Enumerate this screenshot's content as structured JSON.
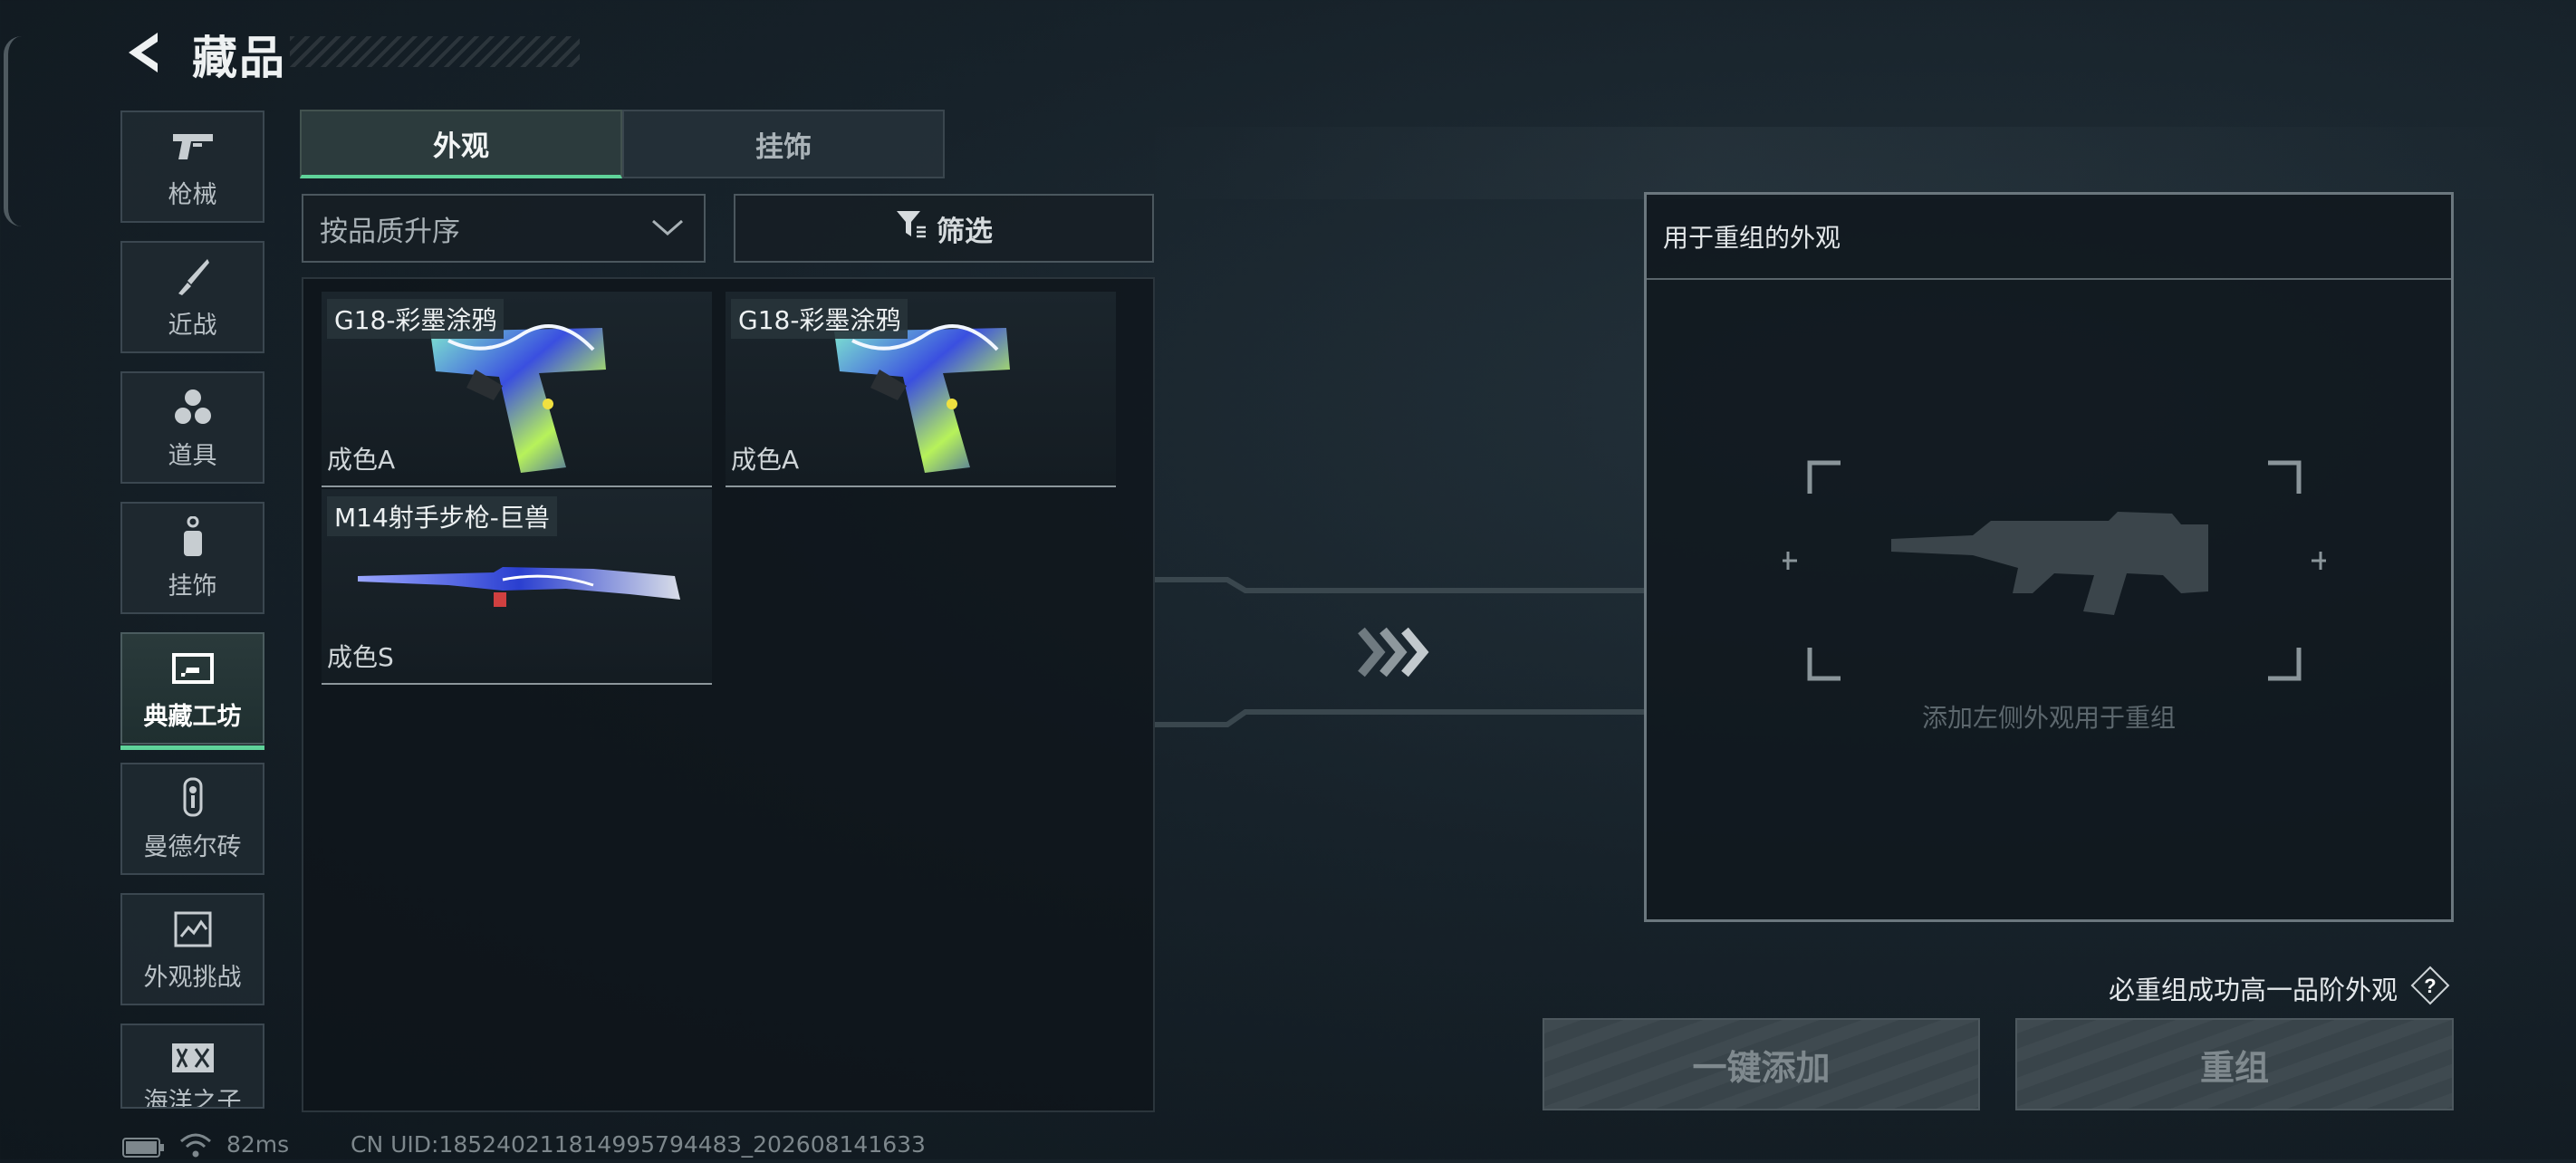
{
  "header": {
    "title": "藏品"
  },
  "sidebar": {
    "items": [
      {
        "label": "枪械",
        "icon": "pistol-icon"
      },
      {
        "label": "近战",
        "icon": "knife-icon"
      },
      {
        "label": "道具",
        "icon": "grenade-stack-icon"
      },
      {
        "label": "挂饰",
        "icon": "charm-tag-icon"
      },
      {
        "label": "典藏工坊",
        "icon": "workshop-frame-icon",
        "active": true
      },
      {
        "label": "曼德尔砖",
        "icon": "brick-key-icon"
      },
      {
        "label": "外观挑战",
        "icon": "challenge-map-icon"
      },
      {
        "label": "海洋之子",
        "icon": "ocean-emblem-icon"
      }
    ]
  },
  "tabs": [
    {
      "label": "外观",
      "active": true
    },
    {
      "label": "挂饰",
      "active": false
    }
  ],
  "sort": {
    "selected": "按品质升序"
  },
  "filter": {
    "label": "筛选"
  },
  "items": [
    {
      "name": "G18-彩墨涂鸦",
      "quality": "成色A"
    },
    {
      "name": "G18-彩墨涂鸦",
      "quality": "成色A"
    },
    {
      "name": "M14射手步枪-巨兽",
      "quality": "成色S"
    }
  ],
  "panel": {
    "title": "用于重组的外观",
    "placeholder": "添加左侧外观用于重组",
    "guarantee": "必重组成功高一品阶外观",
    "add_all_label": "一键添加",
    "reassemble_label": "重组"
  },
  "status": {
    "ping": "82ms",
    "uid": "CN UID:18524021181499579448З_202608141633"
  },
  "colors": {
    "accent": "#5fd39a",
    "panel_border": "#6b777e",
    "button_bg": "#39444a"
  }
}
